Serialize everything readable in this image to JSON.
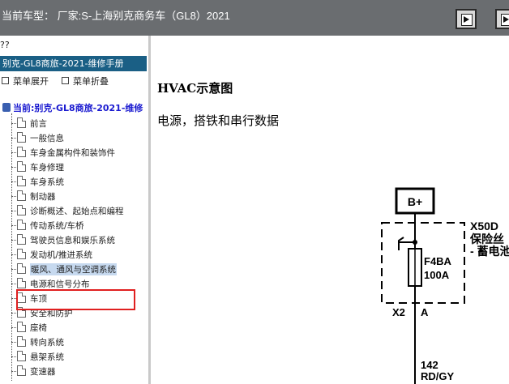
{
  "header": {
    "title": "当前车型： 厂家:S-上海别克商务车（GL8）2021",
    "buttons": [
      {
        "name": "next-page-button",
        "icon": "play-right-icon"
      },
      {
        "name": "last-page-button",
        "icon": "play-right-icon"
      }
    ]
  },
  "sidebar": {
    "unknown_glyphs": "??",
    "manual_title": "别克-GL8商旅-2021-维修手册",
    "expand_label": "菜单展开",
    "collapse_label": "菜单折叠",
    "current_label": "当前:别克-GL8商旅-2021-维修",
    "items": [
      {
        "label": "前言"
      },
      {
        "label": "一般信息"
      },
      {
        "label": "车身金属构件和装饰件"
      },
      {
        "label": "车身修理"
      },
      {
        "label": "车身系统"
      },
      {
        "label": "制动器"
      },
      {
        "label": "诊断概述、起始点和编程"
      },
      {
        "label": "传动系统/车桥"
      },
      {
        "label": "驾驶员信息和娱乐系统"
      },
      {
        "label": "发动机/推进系统"
      },
      {
        "label": "暖风、通风与空调系统",
        "selected": true
      },
      {
        "label": "电源和信号分布"
      },
      {
        "label": "车顶"
      },
      {
        "label": "安全和防护"
      },
      {
        "label": "座椅"
      },
      {
        "label": "转向系统"
      },
      {
        "label": "悬架系统"
      },
      {
        "label": "变速器"
      }
    ]
  },
  "content": {
    "heading": "HVAC示意图",
    "subheading": "电源，搭铁和串行数据",
    "diagram": {
      "power_label": "B+",
      "component_id": "X50D",
      "component_line1": "保险丝",
      "component_line2": "- 蓄电池",
      "fuse_name": "F4BA",
      "fuse_rating": "100A",
      "connector": "X2",
      "pin": "A",
      "circuit_number": "142",
      "wire_color": "RD/GY"
    }
  },
  "colors": {
    "header_bg": "#6a6d70",
    "manual_bar": "#1a5f85",
    "selection_bg": "#c6d9ef",
    "highlight_box": "#e02020",
    "root_text": "#1a1ad0"
  }
}
